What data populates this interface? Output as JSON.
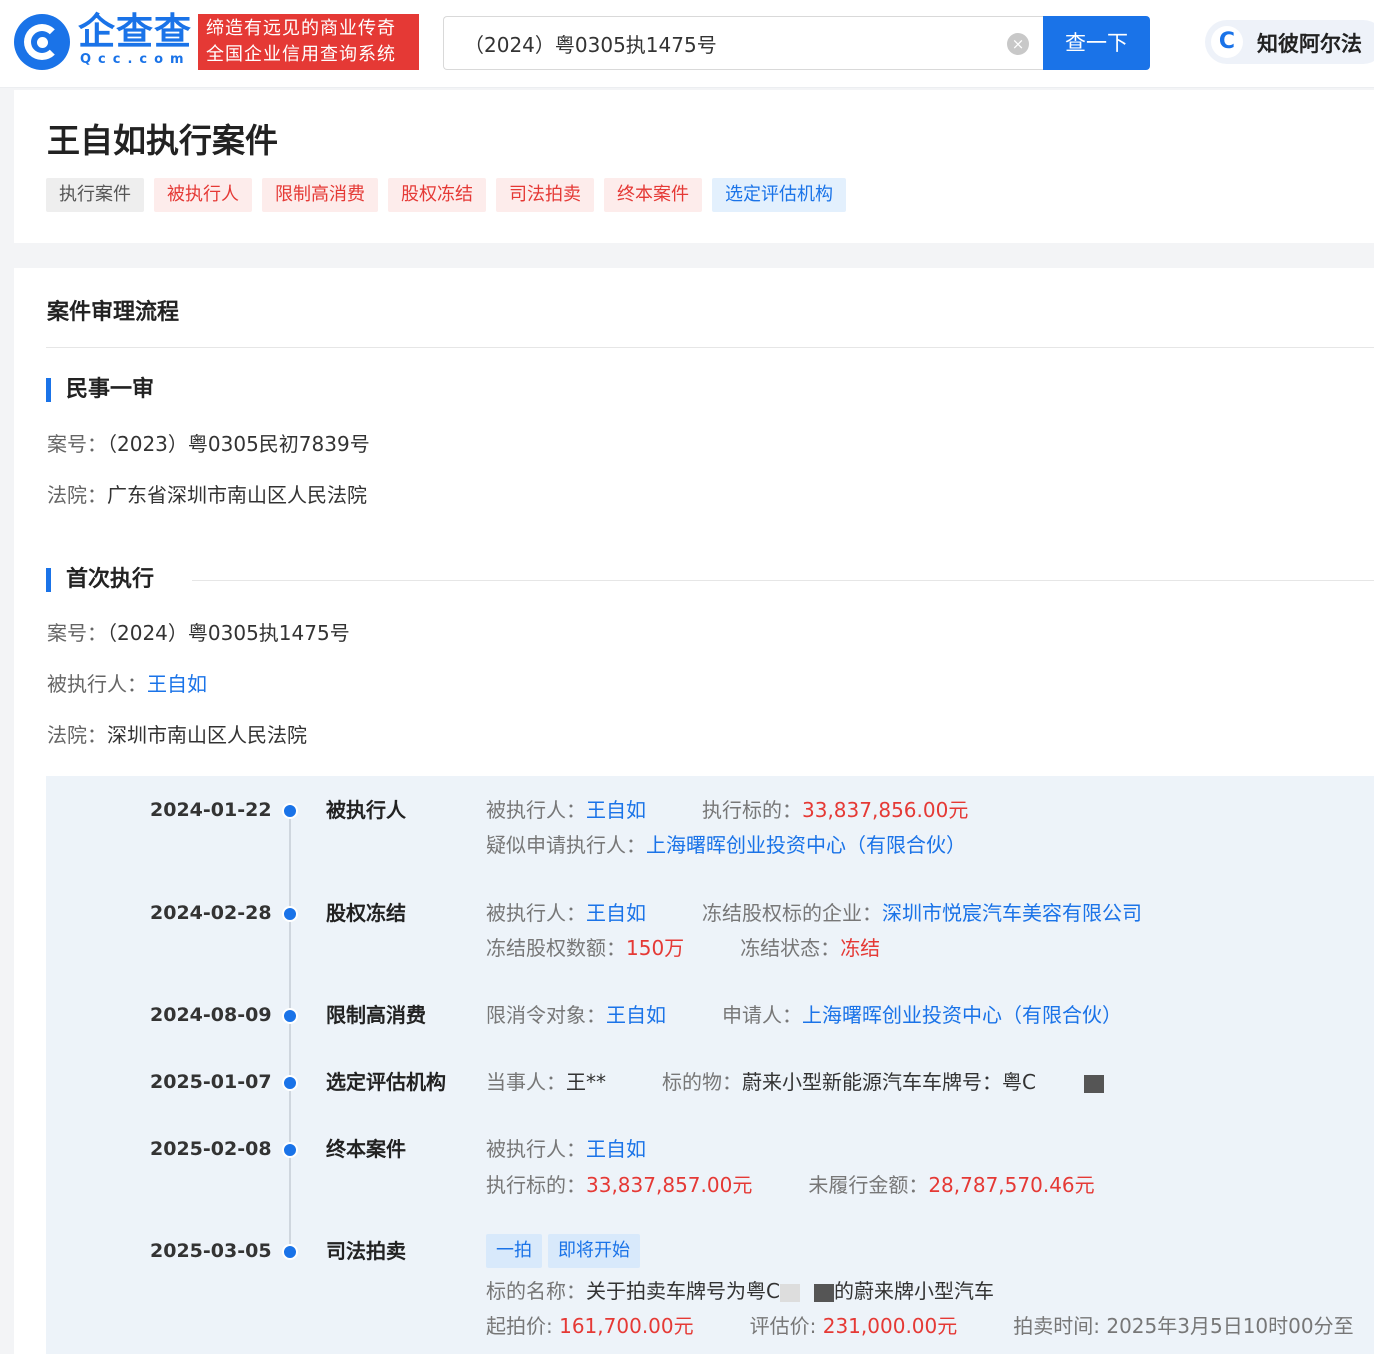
{
  "header": {
    "logo_text": "企查查",
    "logo_sub": "Qcc.com",
    "slogan_line1": "缔造有远见的商业传奇",
    "slogan_line2": "全国企业信用查询系统",
    "search_value": "（2024）粤0305执1475号",
    "clear_icon": "×",
    "search_button": "查一下",
    "zhibi_label": "知彼阿尔法",
    "zhibi_icon": "C"
  },
  "title_card": {
    "title": "王自如执行案件",
    "tags": [
      {
        "label": "执行案件",
        "style": "gray"
      },
      {
        "label": "被执行人",
        "style": "red"
      },
      {
        "label": "限制高消费",
        "style": "red"
      },
      {
        "label": "股权冻结",
        "style": "red"
      },
      {
        "label": "司法拍卖",
        "style": "red"
      },
      {
        "label": "终本案件",
        "style": "red"
      },
      {
        "label": "选定评估机构",
        "style": "blue"
      }
    ]
  },
  "main": {
    "section_title": "案件审理流程",
    "first_trial": {
      "heading": "民事一审",
      "case_no_label": "案号：",
      "case_no": "（2023）粤0305民初7839号",
      "court_label": "法院：",
      "court": "广东省深圳市南山区人民法院"
    },
    "first_exec": {
      "heading": "首次执行",
      "case_no_label": "案号：",
      "case_no": "（2024）粤0305执1475号",
      "person_label": "被执行人：",
      "person": "王自如",
      "court_label": "法院：",
      "court": "深圳市南山区人民法院"
    },
    "timeline": [
      {
        "date": "2024-01-22",
        "type": "被执行人",
        "r1k1": "被执行人：",
        "r1v1": "王自如",
        "r1k2": "执行标的：",
        "r1v2": "33,837,856.00元",
        "r2k1": "疑似申请执行人：",
        "r2v1": "上海曙晖创业投资中心（有限合伙）"
      },
      {
        "date": "2024-02-28",
        "type": "股权冻结",
        "r1k1": "被执行人：",
        "r1v1": "王自如",
        "r1k2": "冻结股权标的企业：",
        "r1v2": "深圳市悦宸汽车美容有限公司",
        "r2k1": "冻结股权数额：",
        "r2v1": "150万",
        "r2k2": "冻结状态：",
        "r2v2": "冻结"
      },
      {
        "date": "2024-08-09",
        "type": "限制高消费",
        "r1k1": "限消令对象：",
        "r1v1": "王自如",
        "r1k2": "申请人：",
        "r1v2": "上海曙晖创业投资中心（有限合伙）"
      },
      {
        "date": "2025-01-07",
        "type": "选定评估机构",
        "r1k1": "当事人：",
        "r1v1": "王**",
        "r1k2": "标的物：",
        "r1v2": "蔚来小型新能源汽车车牌号：粤C"
      },
      {
        "date": "2025-02-08",
        "type": "终本案件",
        "r1k1": "被执行人：",
        "r1v1": "王自如",
        "r2k1": "执行标的：",
        "r2v1": "33,837,857.00元",
        "r2k2": "未履行金额：",
        "r2v2": "28,787,570.46元"
      },
      {
        "date": "2025-03-05",
        "type": "司法拍卖",
        "pill1": "一拍",
        "pill2": "即将开始",
        "name_label": "标的名称：",
        "name_pre": "关于拍卖车牌号为粤C",
        "name_post": "的蔚来牌小型汽车",
        "start_label": "起拍价: ",
        "start_price": "161,700.00元",
        "eval_label": "评估价: ",
        "eval_price": "231,000.00元",
        "time_label": "拍卖时间: ",
        "time_value": "2025年3月5日10时00分至"
      }
    ]
  }
}
